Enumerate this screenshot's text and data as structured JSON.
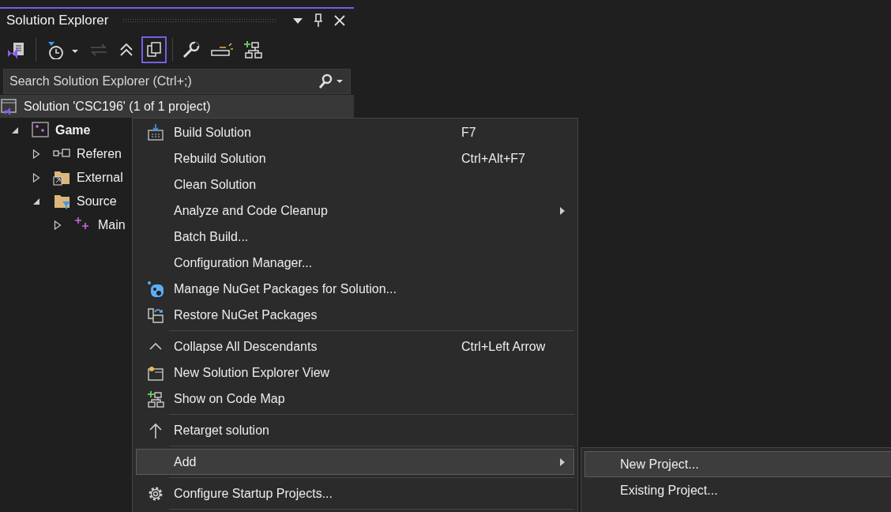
{
  "panel": {
    "title": "Solution Explorer",
    "toolbar": [
      {
        "selected": false,
        "disabled": false
      },
      {
        "selected": false,
        "disabled": false
      },
      {
        "selected": false,
        "disabled": true
      },
      {
        "selected": false,
        "disabled": false
      },
      {
        "selected": true,
        "disabled": false
      },
      {
        "selected": false,
        "disabled": false
      },
      {
        "selected": false,
        "disabled": false
      },
      {
        "selected": false,
        "disabled": false
      }
    ],
    "search": {
      "placeholder": "Search Solution Explorer (Ctrl+;)"
    },
    "tree": [
      {
        "label": "Solution 'CSC196' (1 of 1 project)",
        "selected": true,
        "bold": false,
        "children": [
          {
            "label": "Game",
            "selected": false,
            "bold": true,
            "expanded": true,
            "children": [
              {
                "label": "Referen",
                "selected": false,
                "bold": false,
                "expanded": false
              },
              {
                "label": "External",
                "selected": false,
                "bold": false,
                "expanded": false
              },
              {
                "label": "Source",
                "selected": false,
                "bold": false,
                "expanded": true,
                "children": [
                  {
                    "label": "Main",
                    "selected": false,
                    "bold": false,
                    "expanded": false
                  }
                ]
              }
            ]
          }
        ]
      }
    ]
  },
  "context_menu": {
    "items": [
      {
        "kind": "item",
        "label": "Build Solution",
        "shortcut": "F7",
        "submenu": false,
        "selected": false
      },
      {
        "kind": "item",
        "label": "Rebuild Solution",
        "shortcut": "Ctrl+Alt+F7",
        "submenu": false,
        "selected": false
      },
      {
        "kind": "item",
        "label": "Clean Solution",
        "submenu": false,
        "selected": false
      },
      {
        "kind": "item",
        "label": "Analyze and Code Cleanup",
        "submenu": true,
        "selected": false
      },
      {
        "kind": "item",
        "label": "Batch Build...",
        "submenu": false,
        "selected": false
      },
      {
        "kind": "item",
        "label": "Configuration Manager...",
        "submenu": false,
        "selected": false
      },
      {
        "kind": "item",
        "label": "Manage NuGet Packages for Solution...",
        "submenu": false,
        "selected": false
      },
      {
        "kind": "item",
        "label": "Restore NuGet Packages",
        "submenu": false,
        "selected": false
      },
      {
        "kind": "separator"
      },
      {
        "kind": "item",
        "label": "Collapse All Descendants",
        "shortcut": "Ctrl+Left Arrow",
        "submenu": false,
        "selected": false
      },
      {
        "kind": "item",
        "label": "New Solution Explorer View",
        "submenu": false,
        "selected": false
      },
      {
        "kind": "item",
        "label": "Show on Code Map",
        "submenu": false,
        "selected": false
      },
      {
        "kind": "separator"
      },
      {
        "kind": "item",
        "label": "Retarget solution",
        "submenu": false,
        "selected": false
      },
      {
        "kind": "separator"
      },
      {
        "kind": "item",
        "label": "Add",
        "submenu": true,
        "selected": true
      },
      {
        "kind": "separator"
      },
      {
        "kind": "item",
        "label": "Configure Startup Projects...",
        "submenu": false,
        "selected": false
      },
      {
        "kind": "separator"
      }
    ]
  },
  "submenu": {
    "items": [
      {
        "kind": "item",
        "label": "New Project...",
        "selected": true
      },
      {
        "kind": "item",
        "label": "Existing Project...",
        "selected": false
      }
    ]
  }
}
